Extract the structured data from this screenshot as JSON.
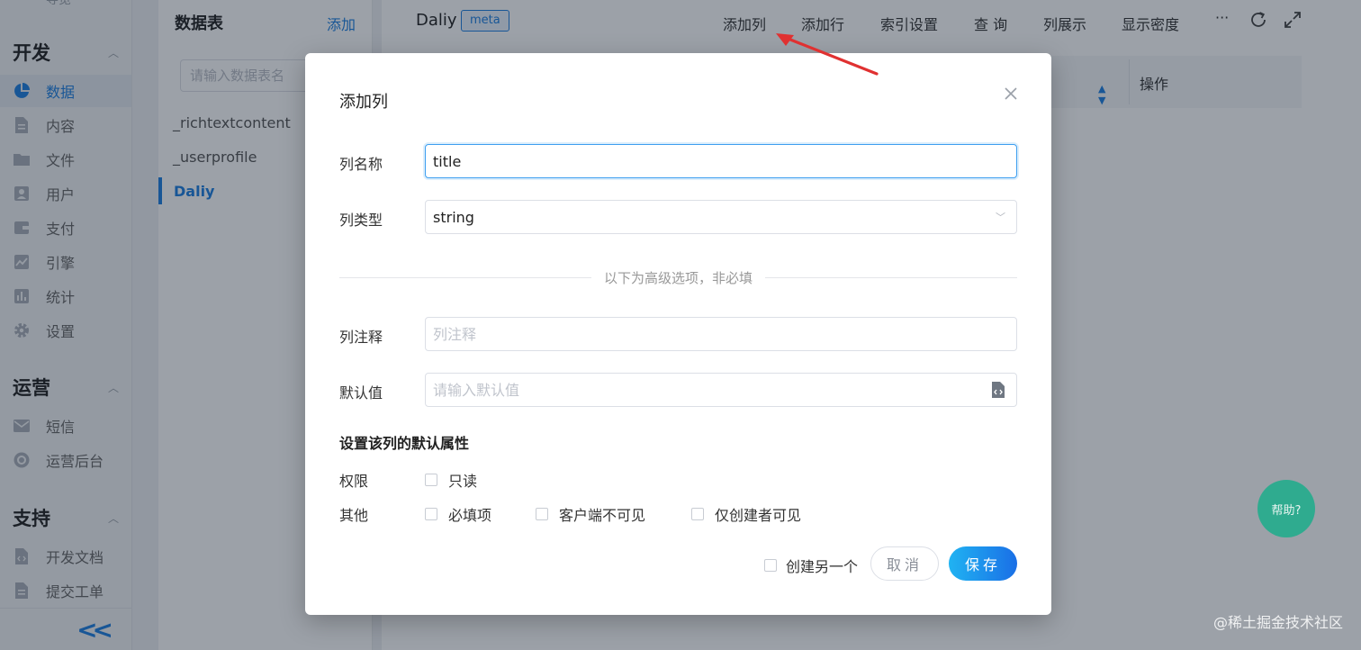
{
  "sidebar": {
    "top_partial": "导览",
    "groups": [
      {
        "title": "开发",
        "items": [
          {
            "label": "数据",
            "icon": "pie-chart-icon"
          },
          {
            "label": "内容",
            "icon": "document-icon"
          },
          {
            "label": "文件",
            "icon": "folder-icon"
          },
          {
            "label": "用户",
            "icon": "user-icon"
          },
          {
            "label": "支付",
            "icon": "wallet-icon"
          },
          {
            "label": "引擎",
            "icon": "trend-icon"
          },
          {
            "label": "统计",
            "icon": "bar-chart-icon"
          },
          {
            "label": "设置",
            "icon": "gear-icon"
          }
        ]
      },
      {
        "title": "运营",
        "items": [
          {
            "label": "短信",
            "icon": "mail-icon"
          },
          {
            "label": "运营后台",
            "icon": "dashboard-icon"
          }
        ]
      },
      {
        "title": "支持",
        "items": [
          {
            "label": "开发文档",
            "icon": "code-doc-icon"
          },
          {
            "label": "提交工单",
            "icon": "ticket-icon"
          }
        ]
      }
    ],
    "collapse_glyph": "<<"
  },
  "tables_panel": {
    "title": "数据表",
    "add_label": "添加",
    "search_placeholder": "请输入数据表名",
    "items": [
      "_richtextcontent",
      "_userprofile",
      "Daliy"
    ]
  },
  "main": {
    "title": "Daliy",
    "badge": "meta",
    "toolbar": [
      "添加列",
      "添加行",
      "索引设置",
      "查 询",
      "列展示",
      "显示密度"
    ],
    "more_glyph": "···",
    "column_op": "操作"
  },
  "modal": {
    "title": "添加列",
    "name_label": "列名称",
    "name_value": "title",
    "type_label": "列类型",
    "type_value": "string",
    "divider_text": "以下为高级选项，非必填",
    "comment_label": "列注释",
    "comment_placeholder": "列注释",
    "default_label": "默认值",
    "default_placeholder": "请输入默认值",
    "attr_title": "设置该列的默认属性",
    "perm_label": "权限",
    "readonly_label": "只读",
    "other_label": "其他",
    "required_label": "必填项",
    "client_hidden_label": "客户端不可见",
    "creator_only_label": "仅创建者可见",
    "create_another_label": "创建另一个",
    "cancel_label": "取消",
    "save_label": "保存"
  },
  "help_label": "帮助?",
  "watermark": "@稀土掘金技术社区",
  "colors": {
    "accent": "#1d7fe0",
    "help": "#2fab8f",
    "arrow": "#e03131"
  }
}
